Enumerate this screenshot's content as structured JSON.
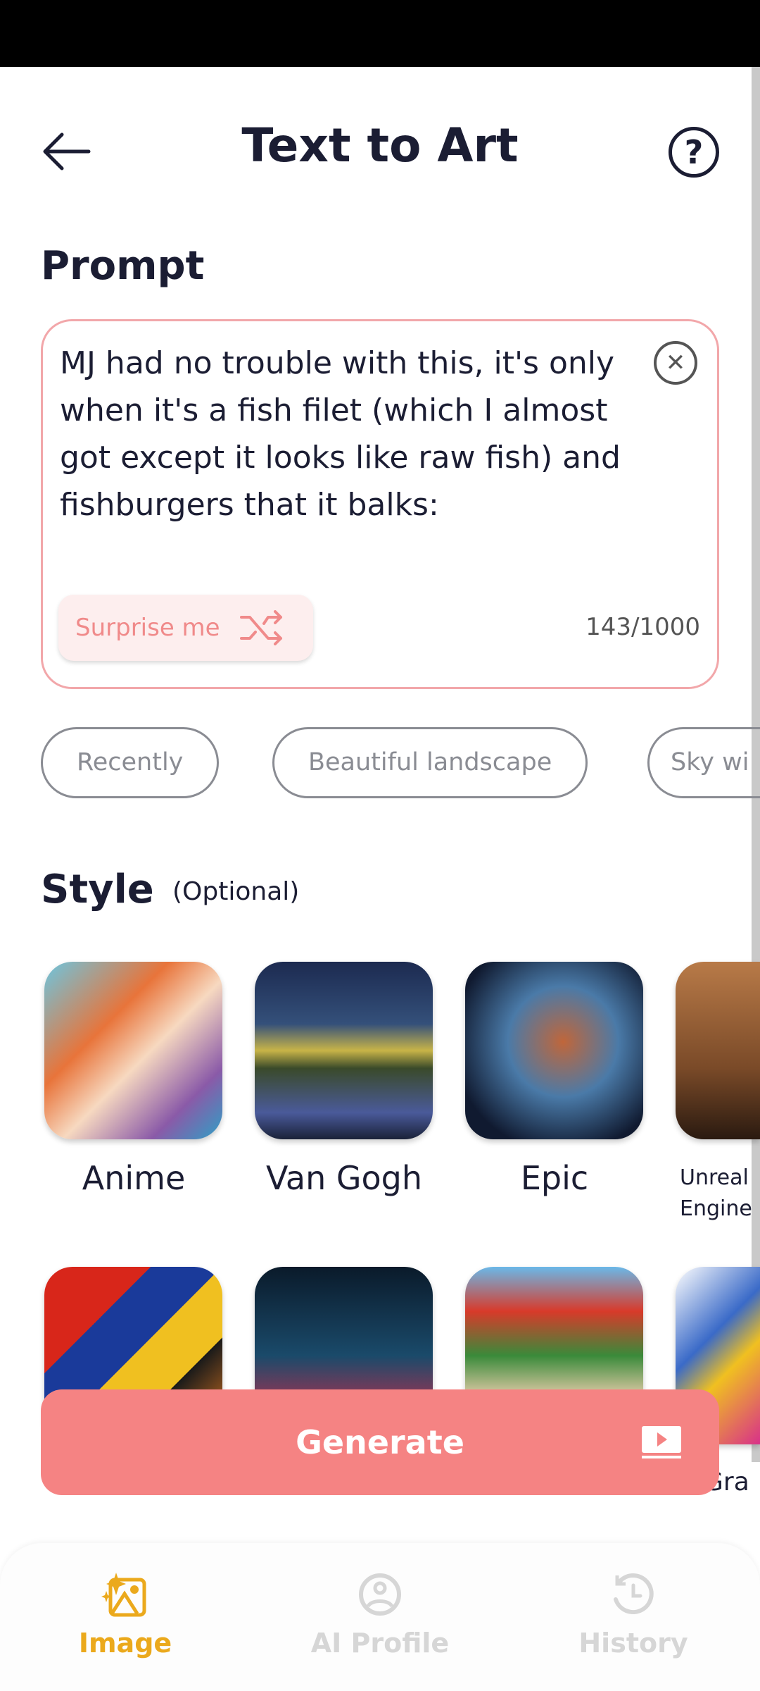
{
  "header": {
    "title": "Text to Art",
    "back_icon": "arrow-left-icon",
    "help_icon": "question-circle-icon"
  },
  "prompt": {
    "label": "Prompt",
    "value": "MJ had no trouble with this, it's only when it's a fish filet (which I almost got except it looks like raw fish) and fishburgers that it balks:",
    "surprise_label": "Surprise me",
    "counter": "143/1000"
  },
  "chips": [
    "Recently",
    "Beautiful landscape",
    "Sky wi"
  ],
  "style": {
    "label": "Style",
    "optional": "(Optional)",
    "items": [
      {
        "label": "Anime"
      },
      {
        "label": "Van Gogh"
      },
      {
        "label": "Epic"
      },
      {
        "label": "Unreal Engine"
      },
      {
        "label": ""
      },
      {
        "label": ""
      },
      {
        "label": ""
      },
      {
        "label": "Gra"
      }
    ]
  },
  "generate": {
    "label": "Generate",
    "icon": "play-video-icon"
  },
  "nav": {
    "items": [
      {
        "label": "Image",
        "active": true
      },
      {
        "label": "AI Profile",
        "active": false
      },
      {
        "label": "History",
        "active": false
      }
    ],
    "active_color": "#EBA91C",
    "inactive_color": "#D6D6D6"
  },
  "colors": {
    "accent": "#F58383",
    "text": "#1B1D33"
  }
}
